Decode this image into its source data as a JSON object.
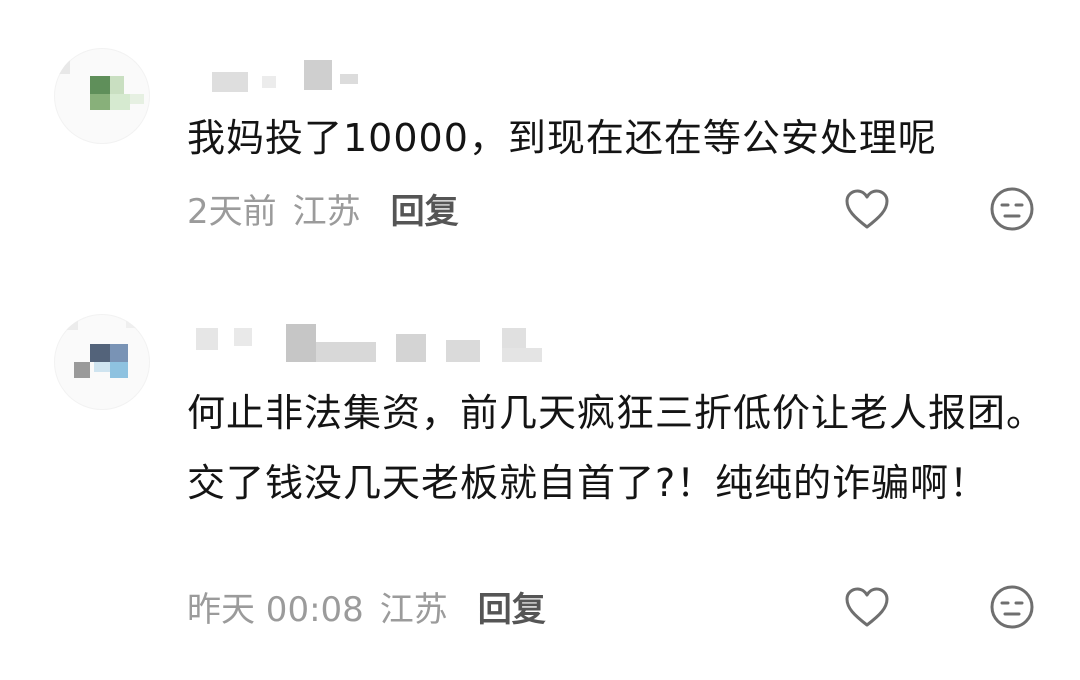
{
  "comments": [
    {
      "text": "我妈投了10000，到现在还在等公安处理呢",
      "time": "2天前",
      "location": "江苏",
      "reply_label": "回复"
    },
    {
      "text": "何止非法集资，前几天疯狂三折低价让老人报团。交了钱没几天老板就自首了?！纯纯的诈骗啊！",
      "time": "昨天 00:08",
      "location": "江苏",
      "reply_label": "回复"
    }
  ],
  "colors": {
    "text": "#141414",
    "meta": "#9b9b9b",
    "reply": "#555555",
    "icon": "#6f6f6f"
  },
  "icons": [
    "heart-icon",
    "dislike-face-icon"
  ]
}
